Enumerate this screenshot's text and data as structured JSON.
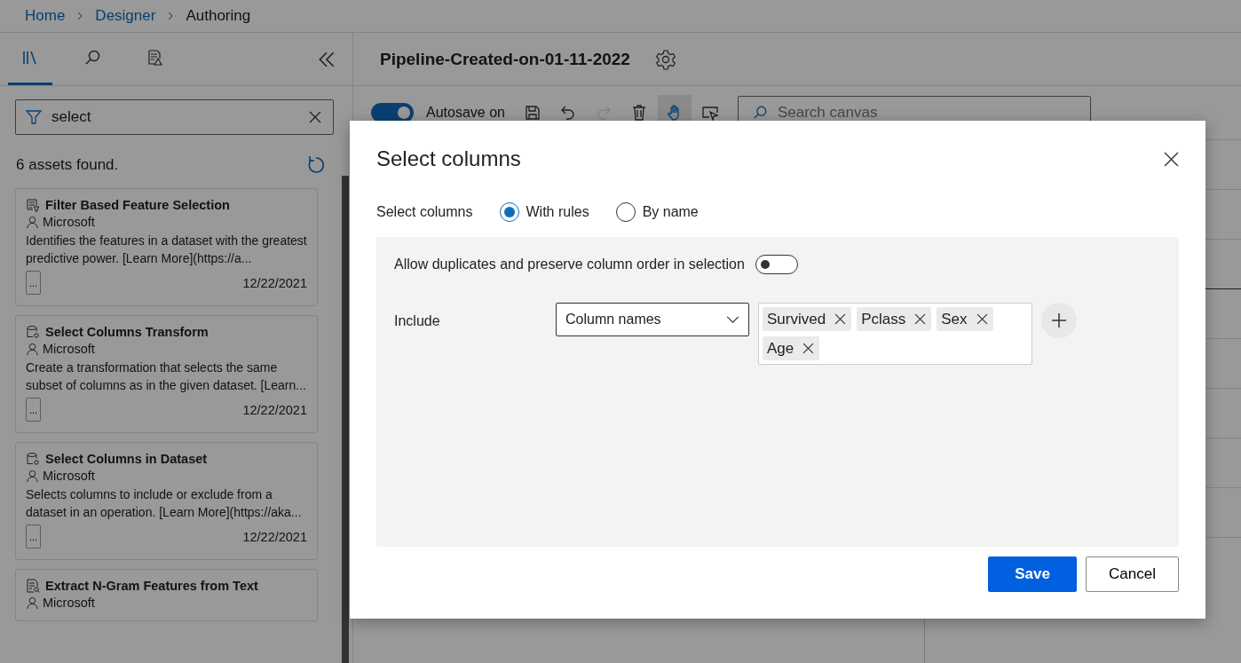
{
  "breadcrumb": [
    {
      "label": "Home",
      "current": false
    },
    {
      "label": "Designer",
      "current": false
    },
    {
      "label": "Authoring",
      "current": true
    }
  ],
  "sidebar": {
    "tabs": [
      {
        "kind": "library",
        "selected": true
      },
      {
        "kind": "search",
        "selected": false
      },
      {
        "kind": "alerts",
        "selected": false
      }
    ],
    "search": {
      "value": "select"
    },
    "result_count": "6 assets found.",
    "assets": [
      {
        "kind": "filter",
        "title": "Filter Based Feature Selection",
        "author": "Microsoft",
        "description": "Identifies the features in a dataset with the greatest predictive power. [Learn More](https://a...",
        "more": "...",
        "date": "12/22/2021"
      },
      {
        "kind": "data",
        "title": "Select Columns Transform",
        "author": "Microsoft",
        "description": "Create a transformation that selects the same subset of columns as in the given dataset. [Learn...",
        "more": "...",
        "date": "12/22/2021"
      },
      {
        "kind": "data",
        "title": "Select Columns in Dataset",
        "author": "Microsoft",
        "description": "Selects columns to include or exclude from a dataset in an operation. [Learn More](https://aka...",
        "more": "...",
        "date": "12/22/2021"
      },
      {
        "kind": "text",
        "title": "Extract N-Gram Features from Text",
        "author": "Microsoft"
      }
    ]
  },
  "pipeline": {
    "title": "Pipeline-Created-on-01-11-2022",
    "autosave": {
      "label": "Autosave on",
      "on": true
    },
    "tools": [
      {
        "kind": "save",
        "selected": false,
        "disabled": false
      },
      {
        "kind": "undo",
        "selected": false,
        "disabled": false
      },
      {
        "kind": "redo",
        "selected": false,
        "disabled": true
      },
      {
        "kind": "delete",
        "selected": false,
        "disabled": false
      },
      {
        "kind": "pan",
        "selected": true,
        "disabled": false
      },
      {
        "kind": "select",
        "selected": false,
        "disabled": false
      }
    ],
    "search": {
      "placeholder": "Search canvas"
    }
  },
  "dialog": {
    "title": "Select columns",
    "mode": {
      "label": "Select columns",
      "options": [
        {
          "label": "With rules",
          "selected": true
        },
        {
          "label": "By name",
          "selected": false
        }
      ]
    },
    "allow_duplicates": {
      "label": "Allow duplicates and preserve column order in selection",
      "on": false
    },
    "include": {
      "label": "Include",
      "dropdown": "Column names",
      "tags": [
        "Survived",
        "Pclass",
        "Sex",
        "Age"
      ]
    },
    "buttons": [
      {
        "kind": "primary",
        "label": "Save"
      },
      {
        "kind": "secondary",
        "label": "Cancel"
      }
    ]
  }
}
